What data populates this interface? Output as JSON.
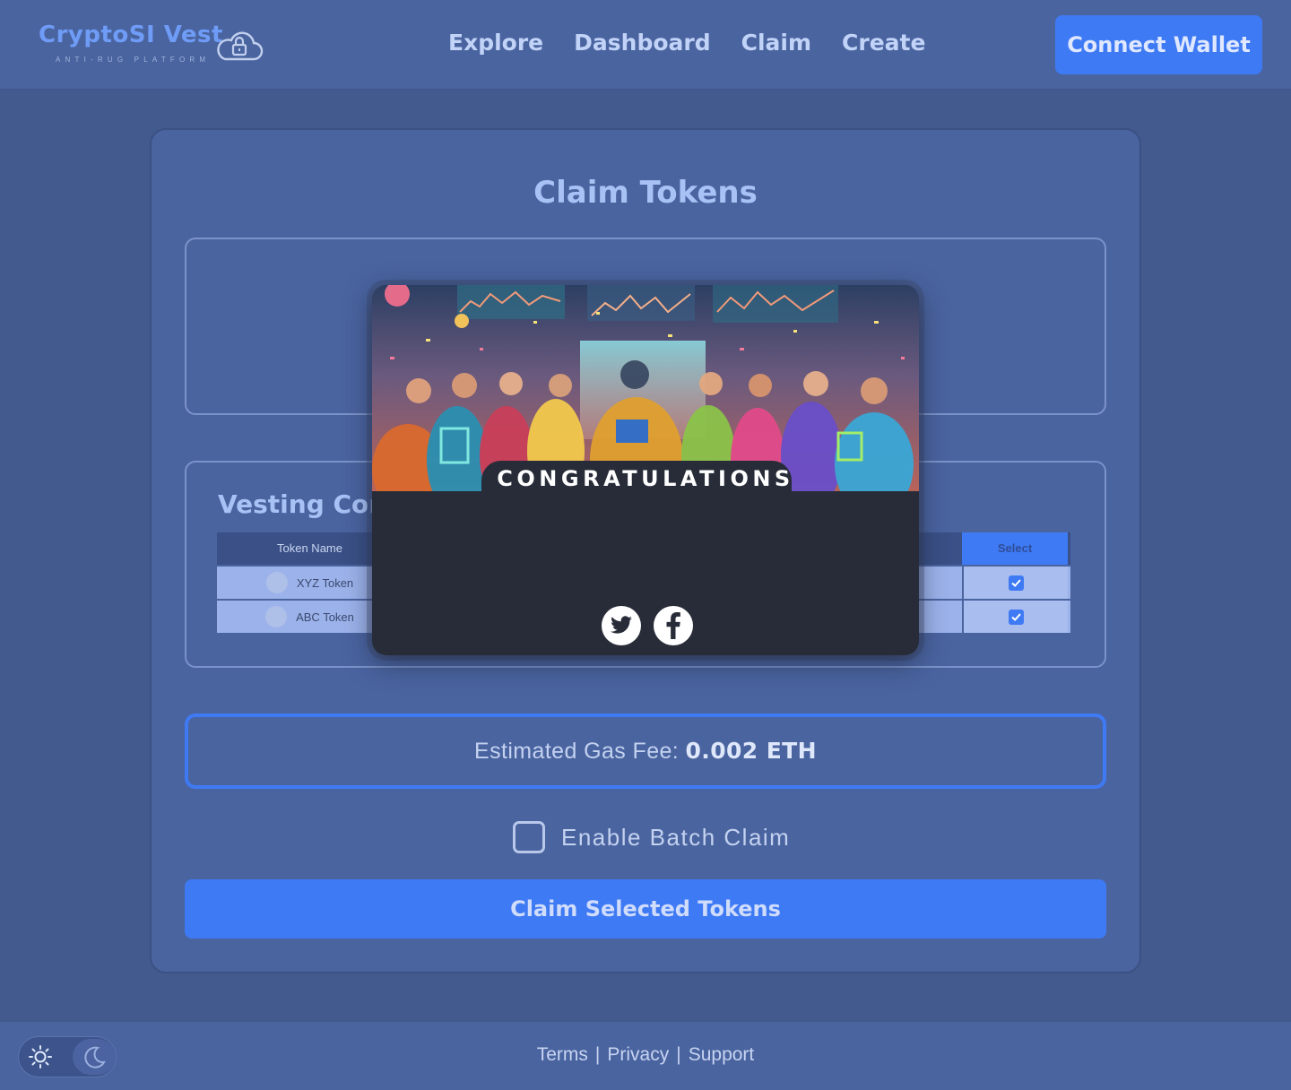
{
  "header": {
    "logo_title": "CryptoSI Vest",
    "logo_subtitle": "ANTI-RUG PLATFORM",
    "nav": [
      "Explore",
      "Dashboard",
      "Claim",
      "Create"
    ],
    "connect_label": "Connect Wallet"
  },
  "main": {
    "title": "Claim Tokens",
    "vesting_title": "Vesting Cont",
    "table": {
      "col_token": "Token Name",
      "col_select": "Select",
      "rows": [
        {
          "token": "XYZ Token",
          "selected": true
        },
        {
          "token": "ABC Token",
          "selected": true
        }
      ]
    },
    "gas_label": "Estimated Gas Fee:",
    "gas_value": "0.002 ETH",
    "batch_label": "Enable Batch Claim",
    "batch_checked": false,
    "claim_label": "Claim Selected Tokens"
  },
  "modal": {
    "heading": "CONGRATULATIONS",
    "socials": [
      "twitter-icon",
      "facebook-icon"
    ]
  },
  "footer": {
    "links": [
      "Terms",
      "Privacy",
      "Support"
    ],
    "separator": "|",
    "theme_icons": [
      "sun-icon",
      "moon-icon"
    ]
  },
  "colors": {
    "accent": "#3f7af5",
    "page_bg": "#425a8e",
    "card_bg": "#4a64a0",
    "modal_bg": "#272c38"
  }
}
